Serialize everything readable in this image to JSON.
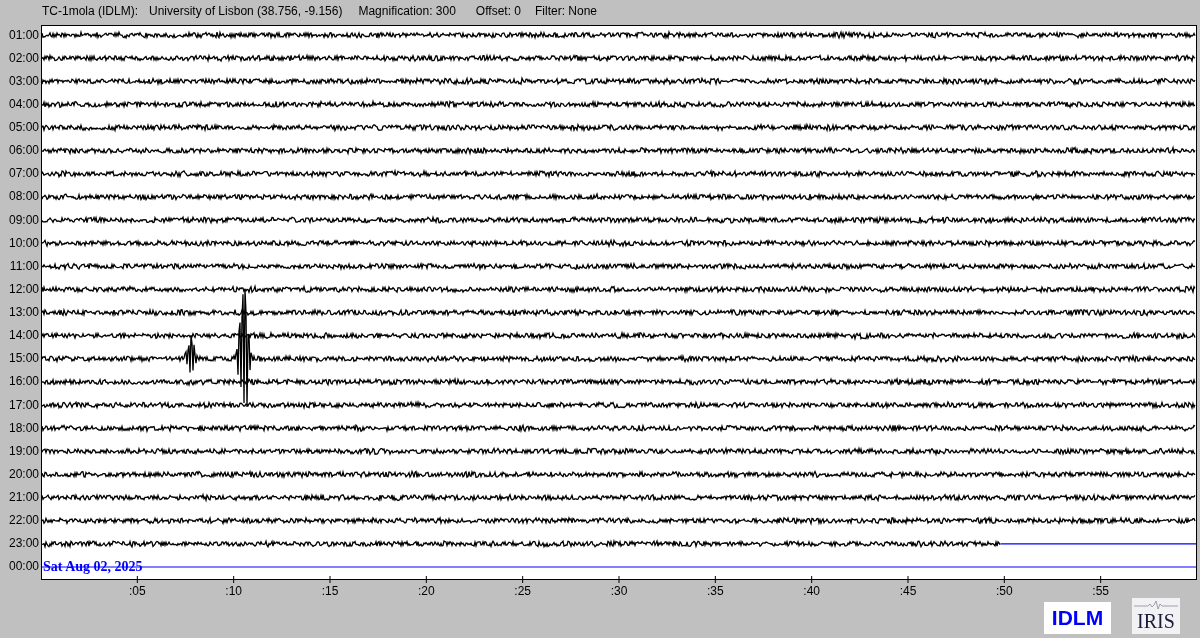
{
  "header": {
    "station": "TC-1mola (IDLM):",
    "location": "University of Lisbon (38.756, -9.156)",
    "magnification": "Magnification: 300",
    "offset": "Offset: 0",
    "filter": "Filter: None"
  },
  "helicorder": {
    "date_label": "Sat Aug 02, 2025",
    "rows": [
      {
        "time": "01:00",
        "kind": "full"
      },
      {
        "time": "02:00",
        "kind": "full"
      },
      {
        "time": "03:00",
        "kind": "full"
      },
      {
        "time": "04:00",
        "kind": "full"
      },
      {
        "time": "05:00",
        "kind": "full"
      },
      {
        "time": "06:00",
        "kind": "full"
      },
      {
        "time": "07:00",
        "kind": "full"
      },
      {
        "time": "08:00",
        "kind": "full"
      },
      {
        "time": "09:00",
        "kind": "full"
      },
      {
        "time": "10:00",
        "kind": "full"
      },
      {
        "time": "11:00",
        "kind": "full"
      },
      {
        "time": "12:00",
        "kind": "full"
      },
      {
        "time": "13:00",
        "kind": "full"
      },
      {
        "time": "14:00",
        "kind": "full"
      },
      {
        "time": "15:00",
        "kind": "event"
      },
      {
        "time": "16:00",
        "kind": "full"
      },
      {
        "time": "17:00",
        "kind": "full"
      },
      {
        "time": "18:00",
        "kind": "full"
      },
      {
        "time": "19:00",
        "kind": "full"
      },
      {
        "time": "20:00",
        "kind": "full"
      },
      {
        "time": "21:00",
        "kind": "full"
      },
      {
        "time": "22:00",
        "kind": "full"
      },
      {
        "time": "23:00",
        "kind": "partial",
        "level": 0.83
      },
      {
        "time": "00:00",
        "kind": "empty"
      }
    ],
    "x_axis_labels": [
      ":05",
      ":10",
      ":15",
      ":20",
      ":25",
      ":30",
      ":35",
      ":40",
      ":45",
      ":50",
      ":55"
    ]
  },
  "logos": {
    "idlm": "IDLM",
    "iris": "IRIS"
  }
}
